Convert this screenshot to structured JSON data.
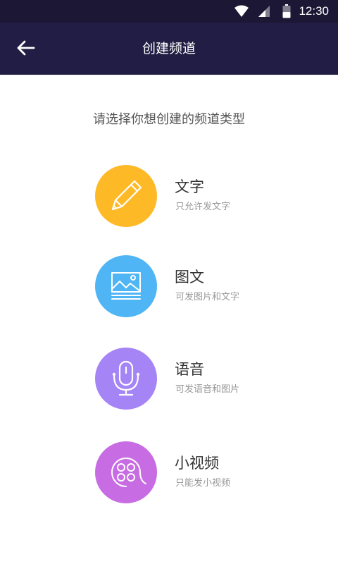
{
  "status_bar": {
    "time": "12:30",
    "icons": [
      "wifi-icon",
      "signal-icon",
      "battery-icon"
    ]
  },
  "header": {
    "title": "创建频道",
    "back_icon": "arrow-left-icon"
  },
  "prompt": "请选择你想创建的频道类型",
  "options": [
    {
      "title": "文字",
      "desc": "只允许发文字",
      "icon": "pencil-icon",
      "color": "#FDB926"
    },
    {
      "title": "图文",
      "desc": "可发图片和文字",
      "icon": "image-icon",
      "color": "#4FB5F5"
    },
    {
      "title": "语音",
      "desc": "可发语音和图片",
      "icon": "microphone-icon",
      "color": "#A584F5"
    },
    {
      "title": "小视频",
      "desc": "只能发小视频",
      "icon": "film-reel-icon",
      "color": "#C86CE3"
    }
  ]
}
